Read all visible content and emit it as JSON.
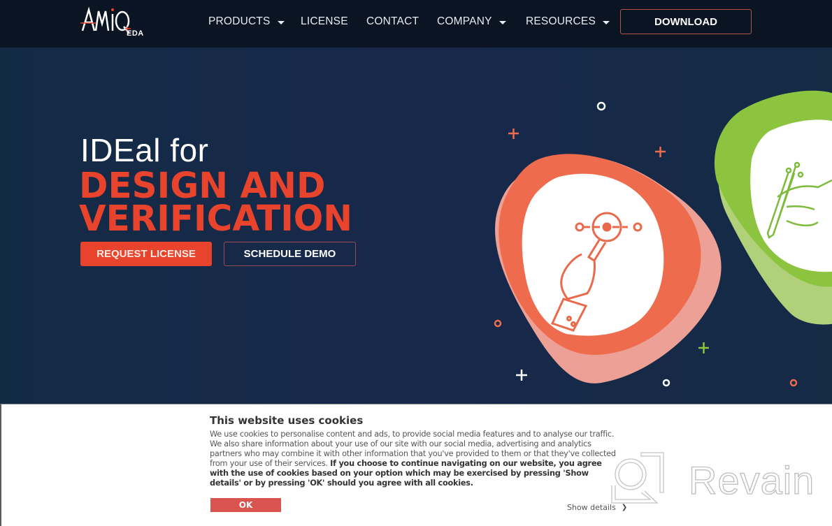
{
  "header": {
    "logo": {
      "brand": "AMIQ",
      "sub": "EDA"
    },
    "nav": [
      {
        "label": "PRODUCTS",
        "dropdown": true
      },
      {
        "label": "LICENSE",
        "dropdown": false
      },
      {
        "label": "CONTACT",
        "dropdown": false
      },
      {
        "label": "COMPANY",
        "dropdown": true
      },
      {
        "label": "RESOURCES",
        "dropdown": true
      }
    ],
    "download_label": "DOWNLOAD"
  },
  "hero": {
    "line1": "IDEal for",
    "line2": "DESIGN AND",
    "line3": "VERIFICATION",
    "request_label": "REQUEST LICENSE",
    "demo_label": "SCHEDULE DEMO",
    "illustrations": [
      "debug-magnifier-bug-icon",
      "hand-writing-pen-icon"
    ]
  },
  "cookie": {
    "title": "This website uses cookies",
    "body_normal": "We use cookies to personalise content and ads, to provide social media features and to analyse our traffic. We also share information about your use of our site with our social media, advertising and analytics partners who may combine it with other information that you've provided to them or that they've collected from your use of their services. ",
    "body_bold": "If you choose to continue navigating on our website, you agree with the use of cookies based on your option which may be exercised by pressing 'Show details' or by pressing 'OK' should you agree with all cookies.",
    "ok_label": "OK",
    "show_details_label": "Show details"
  },
  "watermark": {
    "text": "Revain"
  },
  "colors": {
    "header_bg": "#0b1422",
    "hero_bg": "#18294b",
    "accent_red": "#e8432c",
    "orange_blob": "#ee6c4d",
    "pink_blob": "#eda096",
    "green_blob": "#8cc43f",
    "ok_button": "#d9534f"
  }
}
